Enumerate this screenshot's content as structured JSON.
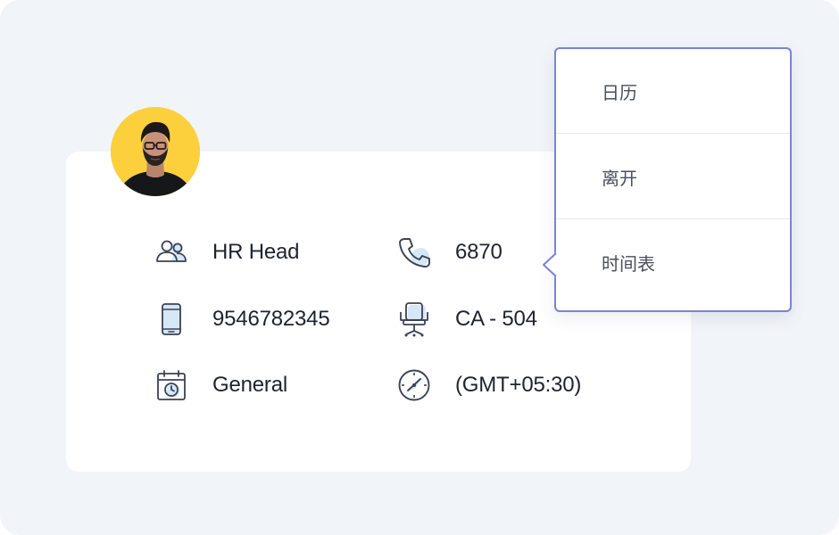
{
  "profile": {
    "role": "HR Head",
    "extension": "6870",
    "mobile": "9546782345",
    "seat": "CA - 504",
    "shift": "General",
    "timezone": "(GMT+05:30)"
  },
  "menu": {
    "items": [
      {
        "label": "日历"
      },
      {
        "label": "离开"
      },
      {
        "label": "时间表"
      }
    ]
  },
  "colors": {
    "background": "#f1f4f8",
    "card": "#ffffff",
    "avatar_bg": "#fcd03d",
    "menu_border": "#7a83d6",
    "icon_stroke": "#3b4256",
    "icon_accent": "#d6e8f7",
    "text": "#1f2330",
    "menu_text": "#4a4f5c"
  },
  "icons": {
    "role": "users-icon",
    "extension": "phone-icon",
    "mobile": "mobile-phone-icon",
    "seat": "office-chair-icon",
    "shift": "calendar-clock-icon",
    "timezone": "compass-clock-icon"
  }
}
